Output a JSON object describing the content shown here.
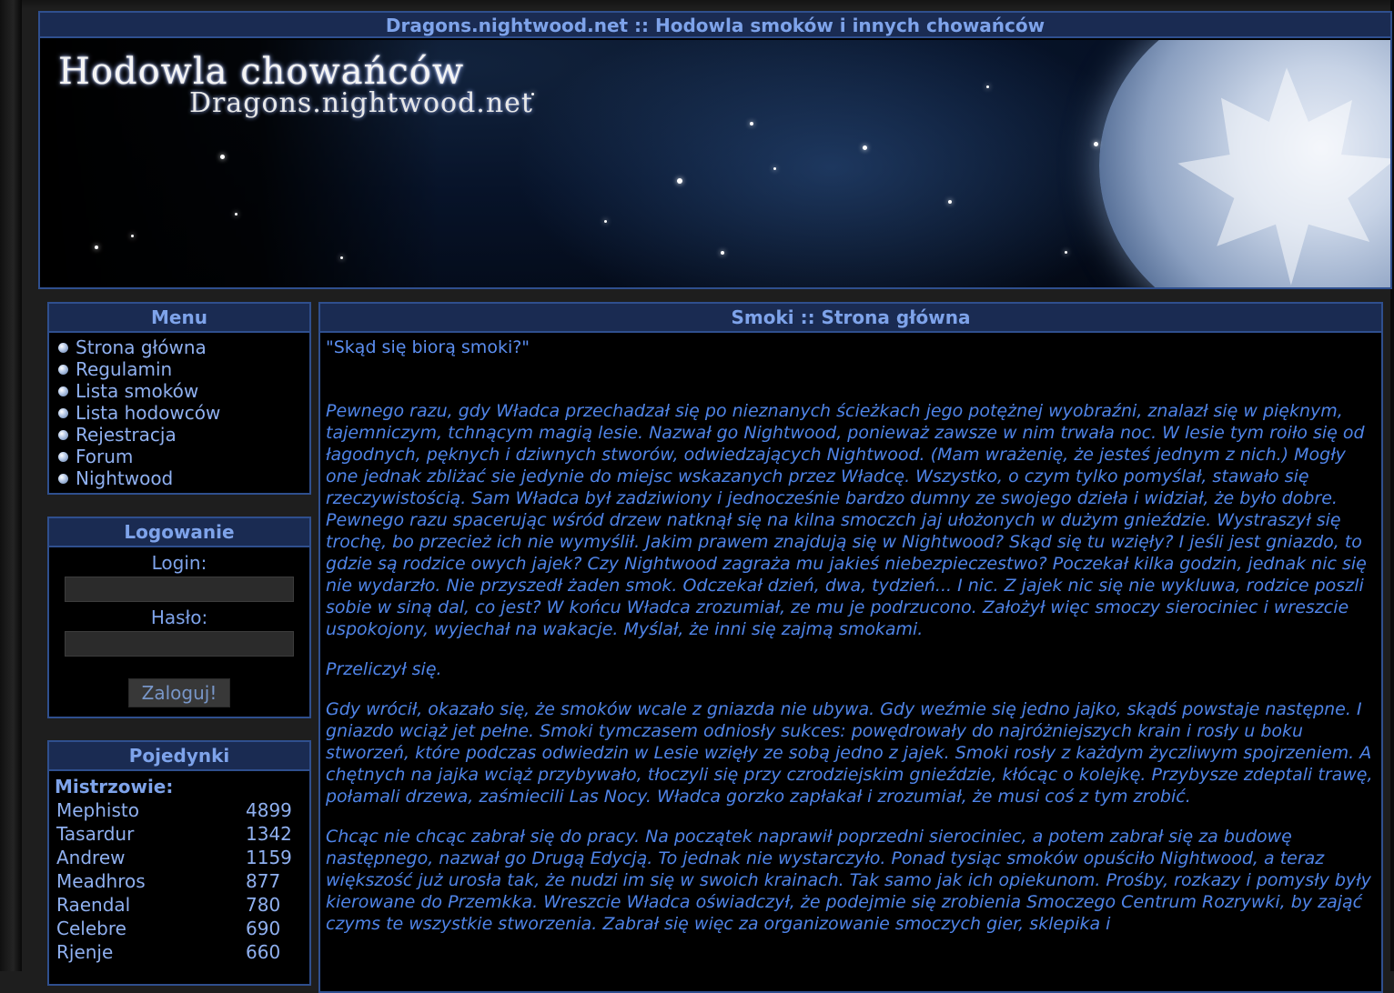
{
  "header": {
    "title": "Dragons.nightwood.net :: Hodowla smoków i innych chowańców",
    "banner_logo_main": "Hodowla chowańców",
    "banner_logo_sub": "Dragons.nightwood.net"
  },
  "menu": {
    "title": "Menu",
    "items": [
      {
        "label": "Strona główna"
      },
      {
        "label": "Regulamin"
      },
      {
        "label": "Lista smoków"
      },
      {
        "label": "Lista hodowców"
      },
      {
        "label": "Rejestracja"
      },
      {
        "label": "Forum"
      },
      {
        "label": "Nightwood"
      }
    ]
  },
  "login": {
    "title": "Logowanie",
    "login_label": "Login:",
    "password_label": "Hasło:",
    "login_value": "",
    "password_value": "",
    "button_label": "Zaloguj!"
  },
  "duels": {
    "title": "Pojedynki",
    "champions_label": "Mistrzowie:",
    "rows": [
      {
        "name": "Mephisto",
        "score": "4899"
      },
      {
        "name": "Tasardur",
        "score": "1342"
      },
      {
        "name": "Andrew",
        "score": "1159"
      },
      {
        "name": "Meadhros",
        "score": "877"
      },
      {
        "name": "Raendal",
        "score": "780"
      },
      {
        "name": "Celebre",
        "score": "690"
      },
      {
        "name": "Rjenje",
        "score": "660"
      }
    ]
  },
  "main": {
    "title": "Smoki :: Strona główna",
    "quote": "\"Skąd się biorą smoki?\"",
    "paragraphs": [
      "Pewnego razu, gdy Władca przechadzał się po nieznanych ścieżkach jego potężnej wyobraźni, znalazł się w pięknym, tajemniczym, tchnącym magią lesie. Nazwał go Nightwood, ponieważ zawsze w nim trwała noc. W lesie tym roiło się od łagodnych, pęknych i dziwnych stworów, odwiedzających Nightwood. (Mam wrażenię, że jesteś jednym z nich.) Mogły one jednak zbliżać sie jedynie do miejsc wskazanych przez Władcę. Wszystko, o czym tylko pomyślał, stawało się rzeczywistością. Sam Władca był zadziwiony i jednocześnie bardzo dumny ze swojego dzieła i widział, że było dobre. Pewnego razu spacerując wśród drzew natknął się na kilna smoczch jaj ułożonych w dużym gnieździe. Wystraszył się trochę, bo przecież ich nie wymyślił. Jakim prawem znajdują się w Nightwood? Skąd się tu wzięły? I jeśli jest gniazdo, to gdzie są rodzice owych jajek? Czy Nightwood zagraża mu jakieś niebezpieczestwo? Poczekał kilka godzin, jednak nic się nie wydarzło. Nie przyszedł żaden smok. Odczekał dzień, dwa, tydzień... I nic. Z jajek nic się nie wykluwa, rodzice poszli sobie w siną dal, co jest? W końcu Władca zrozumiał, ze mu je podrzucono. Założył więc smoczy sierociniec i wreszcie uspokojony, wyjechał na wakacje. Myślał, że inni się zajmą smokami.",
      "Przeliczył się.",
      "Gdy wrócił, okazało się, że smoków wcale z gniazda nie ubywa. Gdy weźmie się jedno jajko, skądś powstaje następne. I gniazdo wciąż jet pełne. Smoki tymczasem odniosły sukces: powędrowały do najróżniejszych krain i rosły u boku stworzeń, które podczas odwiedzin w Lesie wzięły ze sobą jedno z jajek. Smoki rosły z każdym życzliwym spojrzeniem. A chętnych na jajka wciąż przybywało, tłoczyli się przy czrodziejskim gnieździe, kłócąc o kolejkę. Przybysze zdeptali trawę, połamali drzewa, zaśmiecili Las Nocy. Władca gorzko zapłakał i zrozumiał, że musi coś z tym zrobić.",
      "Chcąc nie chcąc zabrał się do pracy. Na początek naprawił poprzedni sierociniec, a potem zabrał się za budowę następnego, nazwał go Drugą Edycją. To jednak nie wystarczyło. Ponad tysiąc smoków opuściło Nightwood, a teraz większość już urosła tak, że nudzi im się w swoich krainach. Tak samo jak ich opiekunom. Prośby, rozkazy i pomysły były kierowane do Przemkka. Wreszcie Władca oświadczył, że podejmie się zrobienia Smoczego Centrum Rozrywki, by zająć czyms te wszystkie stworzenia. Zabrał się więc za organizowanie smoczych gier, sklepika i"
    ]
  },
  "colors": {
    "panel_border": "#2f4f8e",
    "panel_title_bg": "#1a2b52",
    "title_text": "#7ea3ea",
    "link_text": "#8fb0f0",
    "body_text": "#4f84e8",
    "page_bg": "#1e1e1e",
    "panel_bg": "#000000"
  }
}
